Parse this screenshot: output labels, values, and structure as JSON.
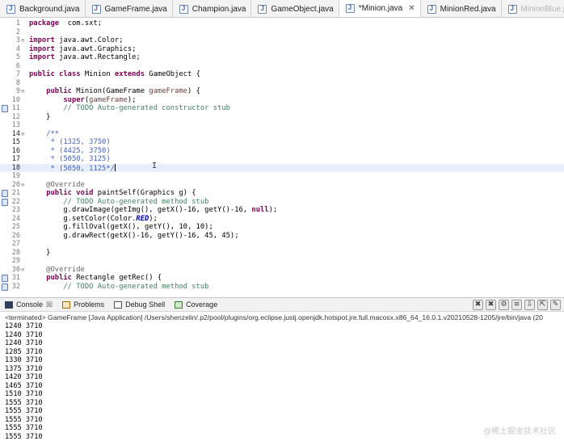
{
  "tabs": [
    {
      "label": "Background.java",
      "active": false
    },
    {
      "label": "GameFrame.java",
      "active": false
    },
    {
      "label": "Champion.java",
      "active": false
    },
    {
      "label": "GameObject.java",
      "active": false
    },
    {
      "label": "*Minion.java",
      "active": true
    },
    {
      "label": "MinionRed.java",
      "active": false
    },
    {
      "label": "MinionBlue.java",
      "active": false
    }
  ],
  "editor": {
    "lines": [
      {
        "n": "1",
        "tokens": [
          [
            "kw",
            "package"
          ],
          [
            "",
            "  com.sxt;"
          ]
        ]
      },
      {
        "n": "2",
        "tokens": []
      },
      {
        "n": "3",
        "fold": "⊖",
        "tokens": [
          [
            "kw",
            "import"
          ],
          [
            "",
            " java.awt.Color;"
          ]
        ]
      },
      {
        "n": "4",
        "tokens": [
          [
            "kw",
            "import"
          ],
          [
            "",
            " java.awt.Graphics;"
          ]
        ]
      },
      {
        "n": "5",
        "tokens": [
          [
            "kw",
            "import"
          ],
          [
            "",
            " java.awt.Rectangle;"
          ]
        ]
      },
      {
        "n": "6",
        "tokens": []
      },
      {
        "n": "7",
        "tokens": [
          [
            "kw",
            "public"
          ],
          [
            "",
            " "
          ],
          [
            "kw",
            "class"
          ],
          [
            "",
            " Minion "
          ],
          [
            "kw",
            "extends"
          ],
          [
            "",
            " GameObject {"
          ]
        ]
      },
      {
        "n": "8",
        "tokens": []
      },
      {
        "n": "9",
        "fold": "⊖",
        "tokens": [
          [
            "",
            "    "
          ],
          [
            "kw",
            "public"
          ],
          [
            "",
            " Minion(GameFrame "
          ],
          [
            "ar",
            "gameFrame"
          ],
          [
            "",
            ") {"
          ]
        ]
      },
      {
        "n": "10",
        "tokens": [
          [
            "",
            "        "
          ],
          [
            "kw",
            "super"
          ],
          [
            "",
            "("
          ],
          [
            "ar",
            "gameFrame"
          ],
          [
            "",
            ");"
          ]
        ]
      },
      {
        "n": "11",
        "marker": true,
        "tokens": [
          [
            "cm",
            "        // TODO Auto-generated constructor stub"
          ]
        ]
      },
      {
        "n": "12",
        "tokens": [
          [
            "",
            "    }"
          ]
        ]
      },
      {
        "n": "13",
        "tokens": []
      },
      {
        "n": "14",
        "fold": "⊖",
        "sel": true,
        "tokens": [
          [
            "dc",
            "    /**"
          ]
        ]
      },
      {
        "n": "15",
        "sel": true,
        "tokens": [
          [
            "dc",
            "     * (1325, 3750)"
          ]
        ]
      },
      {
        "n": "16",
        "sel": true,
        "tokens": [
          [
            "dc",
            "     * (4425, 3750)"
          ]
        ]
      },
      {
        "n": "17",
        "sel": true,
        "tokens": [
          [
            "dc",
            "     * (5050, 3125)"
          ]
        ]
      },
      {
        "n": "18",
        "sel": true,
        "hl": true,
        "caret": true,
        "tokens": [
          [
            "dc",
            "     * (5050, 1125*/"
          ]
        ]
      },
      {
        "n": "19",
        "tokens": []
      },
      {
        "n": "20",
        "fold": "⊖",
        "tokens": [
          [
            "an",
            "    @Override"
          ]
        ]
      },
      {
        "n": "21",
        "marker": true,
        "tokens": [
          [
            "",
            "    "
          ],
          [
            "kw",
            "public"
          ],
          [
            "",
            " "
          ],
          [
            "kw",
            "void"
          ],
          [
            "",
            " paintSelf(Graphics g) {"
          ]
        ]
      },
      {
        "n": "22",
        "marker": true,
        "tokens": [
          [
            "cm",
            "        // TODO Auto-generated method stub"
          ]
        ]
      },
      {
        "n": "23",
        "tokens": [
          [
            "",
            "        g.drawImage(getImg(), getX()-16, getY()-16, "
          ],
          [
            "kw",
            "null"
          ],
          [
            "",
            ");"
          ]
        ]
      },
      {
        "n": "24",
        "tokens": [
          [
            "",
            "        g.setColor(Color."
          ],
          [
            "fd",
            "RED"
          ],
          [
            "",
            ");"
          ]
        ]
      },
      {
        "n": "25",
        "tokens": [
          [
            "",
            "        g.fillOval(getX(), getY(), 10, 10);"
          ]
        ]
      },
      {
        "n": "26",
        "tokens": [
          [
            "",
            "        g.drawRect(getX()-16, getY()-16, 45, 45);"
          ]
        ]
      },
      {
        "n": "27",
        "tokens": []
      },
      {
        "n": "28",
        "tokens": [
          [
            "",
            "    }"
          ]
        ]
      },
      {
        "n": "29",
        "tokens": []
      },
      {
        "n": "30",
        "fold": "⊖",
        "tokens": [
          [
            "an",
            "    @Override"
          ]
        ]
      },
      {
        "n": "31",
        "marker": true,
        "tokens": [
          [
            "",
            "    "
          ],
          [
            "kw",
            "public"
          ],
          [
            "",
            " Rectangle getRec() {"
          ]
        ]
      },
      {
        "n": "32",
        "marker": true,
        "tokens": [
          [
            "cm",
            "        // TODO Auto-generated method stub"
          ]
        ]
      }
    ]
  },
  "console": {
    "views": [
      {
        "label": "Console",
        "icon": "console-icon",
        "close": "☒"
      },
      {
        "label": "Problems",
        "icon": "problems-icon"
      },
      {
        "label": "Debug Shell",
        "icon": "debug-shell-icon"
      },
      {
        "label": "Coverage",
        "icon": "coverage-icon"
      }
    ],
    "toolbar": [
      {
        "glyph": "✖",
        "name": "terminate-icon"
      },
      {
        "glyph": "✖",
        "name": "remove-launch-icon"
      },
      {
        "glyph": "⚙",
        "name": "remove-all-terminated-icon"
      },
      {
        "glyph": "≡",
        "name": "clear-console-icon"
      },
      {
        "glyph": "⇩",
        "name": "scroll-lock-icon"
      },
      {
        "glyph": "⇱",
        "name": "word-wrap-icon"
      },
      {
        "glyph": "✎",
        "name": "pin-console-icon"
      }
    ],
    "terminated": "<terminated> GameFrame [Java Application] /Users/shenzelin/.p2/pool/plugins/org.eclipse.justj.openjdk.hotspot.jre.full.macosx.x86_64_16.0.1.v20210528-1205/jre/bin/java  (20",
    "output": [
      "1240 3710",
      "1240 3710",
      "1240 3710",
      "1285 3710",
      "1330 3710",
      "1375 3710",
      "1420 3710",
      "1465 3710",
      "1510 3710",
      "1555 3710",
      "1555 3710",
      "1555 3710",
      "1555 3710",
      "1555 3710"
    ]
  },
  "watermark": "@稀土掘金技术社区"
}
